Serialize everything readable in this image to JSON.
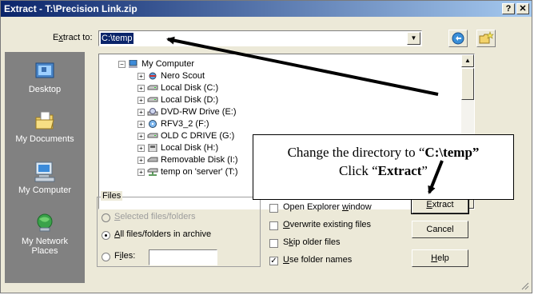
{
  "window": {
    "title": "Extract - T:\\Precision Link.zip",
    "help_btn": "?",
    "close_btn": "✕"
  },
  "extract_to": {
    "label_pre": "E",
    "label_u": "x",
    "label_post": "tract to:",
    "value": "C:\\temp",
    "dropdown_glyph": "▼"
  },
  "places": [
    {
      "label": "Desktop",
      "icon": "desktop-icon"
    },
    {
      "label": "My Documents",
      "icon": "my-documents-icon"
    },
    {
      "label": "My Computer",
      "icon": "my-computer-icon"
    },
    {
      "label_line1": "My Network",
      "label_line2": "Places",
      "icon": "network-places-icon"
    }
  ],
  "tree": {
    "root": "My Computer",
    "items": [
      {
        "label": "Nero Scout",
        "icon": "nero-icon"
      },
      {
        "label": "Local Disk (C:)",
        "icon": "drive-icon"
      },
      {
        "label": "Local Disk (D:)",
        "icon": "drive-icon"
      },
      {
        "label": "DVD-RW Drive (E:)",
        "icon": "dvd-icon"
      },
      {
        "label": "RFV3_2 (F:)",
        "icon": "cd-icon"
      },
      {
        "label": "OLD C DRIVE (G:)",
        "icon": "drive-icon"
      },
      {
        "label": "Local Disk (H:)",
        "icon": "drive-icon"
      },
      {
        "label": "Removable Disk (I:)",
        "icon": "removable-icon"
      },
      {
        "label": "temp on 'server' (T:)",
        "icon": "network-drive-icon"
      }
    ],
    "expand_glyph": "+",
    "collapse_glyph": "−"
  },
  "files_group": {
    "legend": "Files",
    "opt_selected": {
      "pre": "",
      "u": "S",
      "post": "elected files/folders"
    },
    "opt_all": {
      "pre": "",
      "u": "A",
      "post": "ll files/folders in archive"
    },
    "opt_files": {
      "pre": "F",
      "u": "i",
      "post": "les:"
    }
  },
  "options": {
    "open_explorer": {
      "pre": "Open Explorer ",
      "u": "w",
      "post": "indow",
      "checked": false
    },
    "overwrite": {
      "pre": "",
      "u": "O",
      "post": "verwrite existing files",
      "checked": false
    },
    "skip_older": {
      "pre": "S",
      "u": "k",
      "post": "ip older files",
      "checked": false
    },
    "use_folder_names": {
      "pre": "",
      "u": "U",
      "post": "se folder names",
      "checked": true,
      "mark": "✓"
    }
  },
  "buttons": {
    "extract": {
      "pre": "",
      "u": "E",
      "post": "xtract"
    },
    "cancel": "Cancel",
    "help": {
      "pre": "",
      "u": "H",
      "post": "elp"
    }
  },
  "callout": {
    "line1_pre": "Change the directory to “",
    "line1_bold": "C:\\temp”",
    "line2_pre": "Click “",
    "line2_bold": "Extract",
    "line2_post": "”"
  },
  "colors": {
    "titlebar_start": "#0a246a",
    "titlebar_end": "#a6caf0",
    "dialog_bg": "#ece9d8",
    "places_bg": "#818181",
    "selection": "#0a246a"
  }
}
